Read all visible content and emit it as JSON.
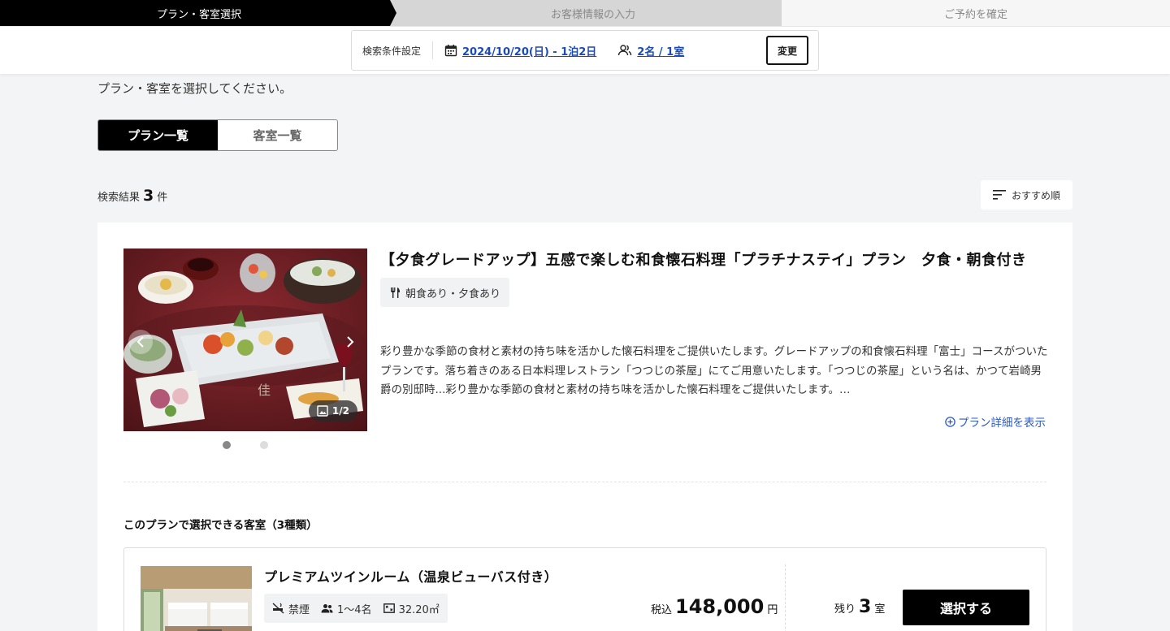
{
  "steps": [
    {
      "label": "プラン・客室選択",
      "active": true
    },
    {
      "label": "お客様情報の入力",
      "active": false
    },
    {
      "label": "ご予約を確定",
      "active": false
    }
  ],
  "search": {
    "label": "検索条件設定",
    "date": "2024/10/20(日) - 1泊2日",
    "guests": "2名 / 1室",
    "change_label": "変更"
  },
  "instruction": "プラン・客室を選択してください。",
  "tabs": [
    {
      "label": "プラン一覧",
      "active": true
    },
    {
      "label": "客室一覧",
      "active": false
    }
  ],
  "results": {
    "prefix": "検索結果",
    "count": "3",
    "suffix": "件"
  },
  "sort": {
    "label": "おすすめ順",
    "icon": "sort-icon"
  },
  "plan": {
    "title": "【夕食グレードアップ】五感で楽しむ和食懐石料理「プラチナステイ」プラン　夕食・朝食付き",
    "meal_tag": "朝食あり・夕食あり",
    "meal_icon": "utensils-icon",
    "description": "彩り豊かな季節の食材と素材の持ち味を活かした懐石料理をご提供いたします。グレードアップの和食懐石料理「富士」コースがついたプランです。落ち着きのある日本料理レストラン「つつじの茶屋」にてご用意いたします。「つつじの茶屋」という名は、かつて岩崎男爵の別邸時...彩り豊かな季節の食材と素材の持ち味を活かした懐石料理をご提供いたします。…",
    "detail_link": "プラン詳細を表示",
    "photo_counter": "1/2",
    "photo_total": 2,
    "photo_index": 1
  },
  "rooms": {
    "heading": "このプランで選択できる客室（3種類）",
    "items": [
      {
        "name": "プレミアムツインルーム（温泉ビューバス付き）",
        "smoking": "禁煙",
        "capacity": "1〜4名",
        "area": "32.20㎡",
        "price_label": "税込",
        "price": "148,000",
        "price_unit": "円",
        "remain_label": "残り",
        "remain": "3",
        "remain_unit": "室",
        "select_label": "選択する"
      }
    ]
  }
}
